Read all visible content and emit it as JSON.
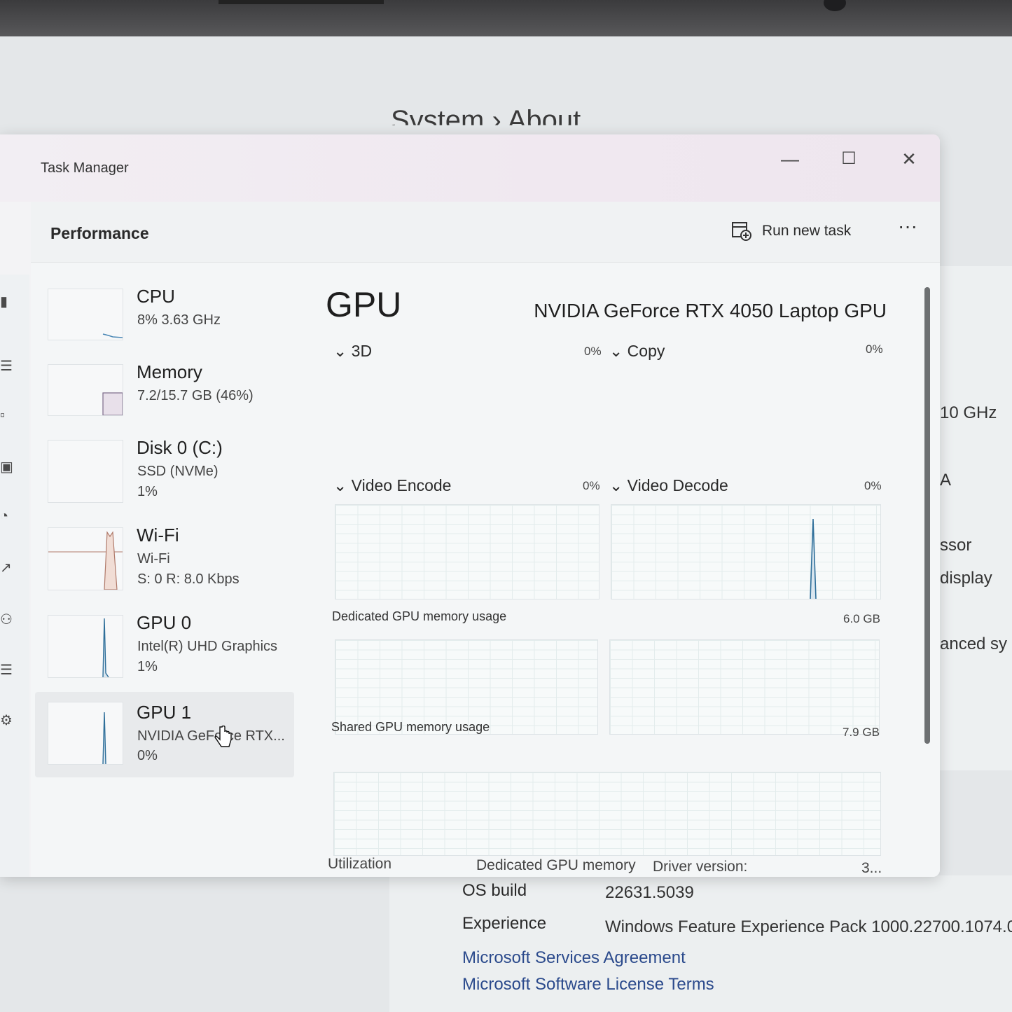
{
  "background": {
    "settings_title": "System  ›  About",
    "right_fragments": [
      "10 GHz",
      "A",
      "ssor",
      "display",
      "anced sy"
    ],
    "rows": [
      {
        "label": "OS build",
        "value": "22631.5039"
      },
      {
        "label": "Experience",
        "value": "Windows Feature Experience Pack 1000.22700.1074.0"
      }
    ],
    "links": [
      "Microsoft Services Agreement",
      "Microsoft Software License Terms"
    ]
  },
  "window": {
    "title": "Task Manager",
    "minimize": "—",
    "maximize": "☐",
    "close": "✕"
  },
  "header": {
    "title": "Performance",
    "run_new_task": "Run new task",
    "more": "···"
  },
  "devices": [
    {
      "name": "CPU",
      "line1": "8%  3.63 GHz",
      "line2": ""
    },
    {
      "name": "Memory",
      "line1": "7.2/15.7 GB (46%)",
      "line2": ""
    },
    {
      "name": "Disk 0 (C:)",
      "line1": "SSD (NVMe)",
      "line2": "1%"
    },
    {
      "name": "Wi-Fi",
      "line1": "Wi-Fi",
      "line2": "S: 0  R: 8.0 Kbps"
    },
    {
      "name": "GPU 0",
      "line1": "Intel(R) UHD Graphics",
      "line2": "1%"
    },
    {
      "name": "GPU 1",
      "line1": "NVIDIA GeForce RTX...",
      "line2": "0%"
    }
  ],
  "gpu": {
    "heading": "GPU",
    "model": "NVIDIA GeForce RTX 4050 Laptop GPU",
    "engines": [
      {
        "label": "3D",
        "percent": "0%"
      },
      {
        "label": "Copy",
        "percent": "0%"
      },
      {
        "label": "Video Encode",
        "percent": "0%"
      },
      {
        "label": "Video Decode",
        "percent": "0%"
      }
    ],
    "dedicated_label": "Dedicated GPU memory usage",
    "dedicated_max": "6.0 GB",
    "shared_label": "Shared GPU memory usage",
    "shared_max": "7.9 GB",
    "footer": {
      "utilization": "Utilization",
      "dedicated_memory": "Dedicated GPU memory",
      "driver_version": "Driver version:",
      "driver_value": "3..."
    }
  },
  "colors": {
    "accent_gpu": "#2f6f9a",
    "wifi_line": "#b07a6a",
    "link": "#2b4a8c"
  }
}
